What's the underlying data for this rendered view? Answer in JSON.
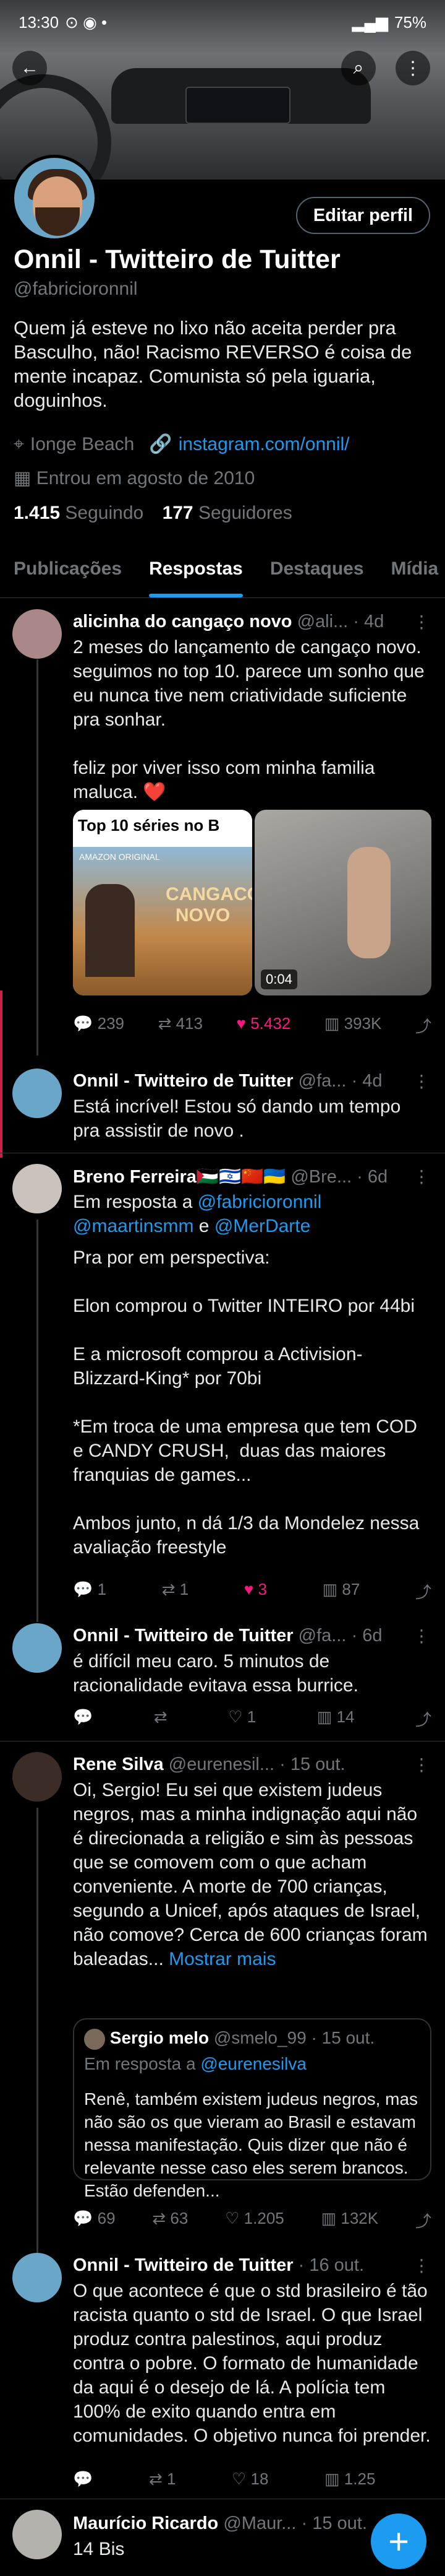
{
  "status": {
    "time": "13:30",
    "battery": "75%"
  },
  "profile": {
    "edit_label": "Editar perfil",
    "name": "Onnil - Twitteiro de Tuitter",
    "handle": "@fabricioronnil",
    "bio": "Quem já esteve no lixo não aceita perder pra Basculho, não!  Racismo REVERSO é coisa de mente incapaz.  Comunista só pela iguaria, doguinhos.",
    "location": "Ionge Beach",
    "link": "instagram.com/onnil/",
    "joined": "Entrou em agosto de 2010",
    "following_count": "1.415",
    "following_label": "Seguindo",
    "followers_count": "177",
    "followers_label": "Seguidores"
  },
  "tabs": [
    "Publicações",
    "Respostas",
    "Destaques",
    "Mídia"
  ],
  "tweets": [
    {
      "name": "alicinha do cangaço novo",
      "handle": "@ali...",
      "time": "· 4d",
      "text": "2 meses do lançamento de cangaço novo. seguimos no top 10. parece um sonho que eu nunca tive nem criatividade suficiente pra sonhar.\n\nfeliz por viver isso com minha familia maluca. ❤️",
      "media_title": "Top 10 séries no B",
      "poster_top": "AMAZON ORIGINAL",
      "poster_title": "CANGACO NOVO",
      "video_time": "0:04",
      "replies": "239",
      "retweets": "413",
      "likes": "5.432",
      "views": "393K"
    },
    {
      "name": "Onnil - Twitteiro de Tuitter",
      "handle": "@fa...",
      "time": "· 4d",
      "text": "Está incrível! Estou só dando um tempo pra assistir de novo ."
    },
    {
      "name": "Breno Ferreira🇵🇸🇮🇱🇨🇳🇺🇦",
      "handle": "@Bre...",
      "time": "· 6d",
      "reply_prefix": "Em resposta a ",
      "reply_m1": "@fabricioronnil",
      "reply_m2": "@maartinsmm",
      "reply_e": " e ",
      "reply_m3": "@MerDarte",
      "text": "Pra por em perspectiva:\n\nElon comprou o Twitter INTEIRO por 44bi\n\nE a microsoft comprou a Activision-Blizzard-King* por 70bi\n\n*Em troca de uma empresa que tem COD e CANDY CRUSH,  duas das maiores franquias de games...\n\nAmbos junto, n dá 1/3 da Mondelez nessa avaliação freestyle",
      "replies": "1",
      "retweets": "1",
      "likes": "3",
      "views": "87"
    },
    {
      "name": "Onnil - Twitteiro de Tuitter",
      "handle": "@fa...",
      "time": "· 6d",
      "text": "é difícil meu caro. 5 minutos de racionalidade evitava essa burrice.",
      "replies": "",
      "likes": "1",
      "views": "14"
    },
    {
      "name": "Rene Silva",
      "handle": "@eurenesil...",
      "time": "· 15 out.",
      "text": "Oi, Sergio! Eu sei que existem judeus negros, mas a minha indignação aqui não é direcionada a religião e sim às pessoas que se comovem com o que acham conveniente. A morte de 700 crianças, segundo a Unicef, após ataques de Israel, não comove? Cerca de 600 crianças foram baleadas... ",
      "more": "Mostrar mais",
      "q_name": "Sergio melo",
      "q_handle": "@smelo_99",
      "q_time": "· 15 out.",
      "q_reply_prefix": "Em resposta a ",
      "q_reply_m": "@eurenesilva",
      "q_text": "Renê, também existem judeus negros, mas não são os que vieram ao Brasil e estavam nessa manifestação. Quis dizer que não é relevante nesse caso eles serem brancos. Estão defenden...",
      "replies": "69",
      "retweets": "63",
      "likes": "1.205",
      "views": "132K"
    },
    {
      "name": "Onnil - Twitteiro de Tuitter",
      "handle": "",
      "time": "· 16 out.",
      "text": "O que acontece é que o std brasileiro é tão racista quanto o std de Israel. O que Israel produz contra palestinos, aqui produz contra o pobre. O formato de humanidade da aqui é o desejo de lá. A polícia tem 100% de exito quando entra em comunidades. O objetivo nunca foi prender.",
      "replies": "",
      "retweets": "1",
      "likes": "18",
      "views": "1.25"
    },
    {
      "name": "Maurício Ricardo",
      "handle": "@Maur...",
      "time": "· 15 out.",
      "text": "14 Bis"
    }
  ]
}
